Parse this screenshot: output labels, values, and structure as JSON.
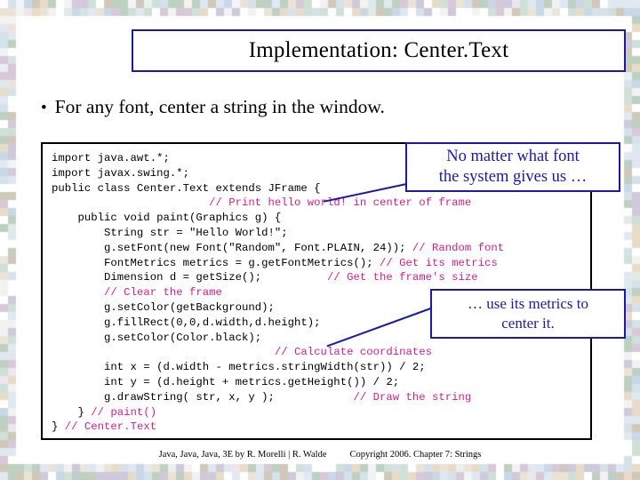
{
  "slide": {
    "title": "Implementation: Center.Text",
    "bullet_marker": "•",
    "bullet": "For any font, center a string in the window.",
    "code_lines": [
      "import java.awt.*;",
      "import javax.swing.*;",
      "public class Center.Text extends JFrame {",
      "                        // Print hello world! in center of frame",
      "    public void paint(Graphics g) {",
      "        String str = \"Hello World!\";",
      "        g.setFont(new Font(\"Random\", Font.PLAIN, 24)); // Random font",
      "        FontMetrics metrics = g.getFontMetrics(); // Get its metrics",
      "        Dimension d = getSize();          // Get the frame's size",
      "        // Clear the frame",
      "        g.setColor(getBackground);",
      "        g.fillRect(0,0,d.width,d.height);",
      "        g.setColor(Color.black);",
      "                                  // Calculate coordinates",
      "        int x = (d.width - metrics.stringWidth(str)) / 2;",
      "        int y = (d.height + metrics.getHeight()) / 2;",
      "        g.drawString( str, x, y );            // Draw the string",
      "    } // paint()",
      "} // Center.Text"
    ],
    "callout_1_line_1": "No matter what font",
    "callout_1_line_2": "the system gives us …",
    "callout_2_line_1": "… use its metrics to",
    "callout_2_line_2": "center it.",
    "footer_left": "Java, Java, Java, 3E by R. Morelli | R. Walde",
    "footer_right": "Copyright 2006. Chapter 7: Strings"
  },
  "colors": {
    "title_border": "#1a1aa8",
    "callout_text": "#1a1aa8",
    "code_comment": "#d21f8a",
    "code_text": "#000000"
  }
}
